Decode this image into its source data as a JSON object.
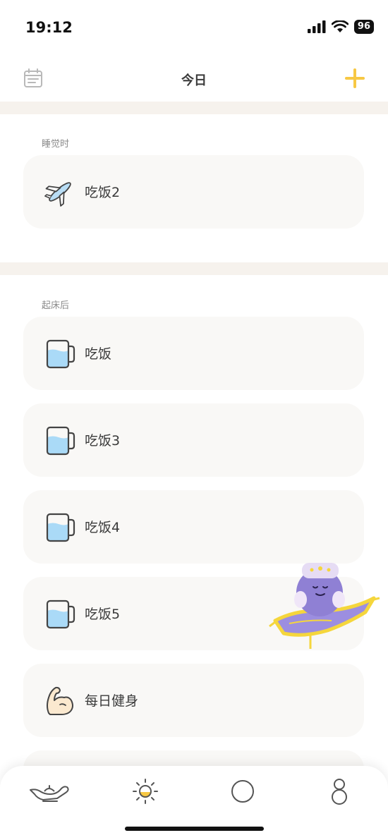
{
  "status_bar": {
    "time": "19:12",
    "battery": "96"
  },
  "header": {
    "title": "今日",
    "accent_color": "#f7c844"
  },
  "sections": [
    {
      "label": "睡觉时",
      "items": [
        {
          "label": "吃饭2",
          "icon": "airplane-icon"
        }
      ]
    },
    {
      "label": "起床后",
      "items": [
        {
          "label": "吃饭",
          "icon": "water-cup-icon"
        },
        {
          "label": "吃饭3",
          "icon": "water-cup-icon"
        },
        {
          "label": "吃饭4",
          "icon": "water-cup-icon"
        },
        {
          "label": "吃饭5",
          "icon": "water-cup-icon"
        },
        {
          "label": "每日健身",
          "icon": "flexed-arm-icon"
        }
      ]
    }
  ],
  "tab_bar": [
    {
      "icon": "magic-lamp-icon"
    },
    {
      "icon": "sun-icon",
      "active": true
    },
    {
      "icon": "circle-icon"
    },
    {
      "icon": "person-icon"
    }
  ]
}
